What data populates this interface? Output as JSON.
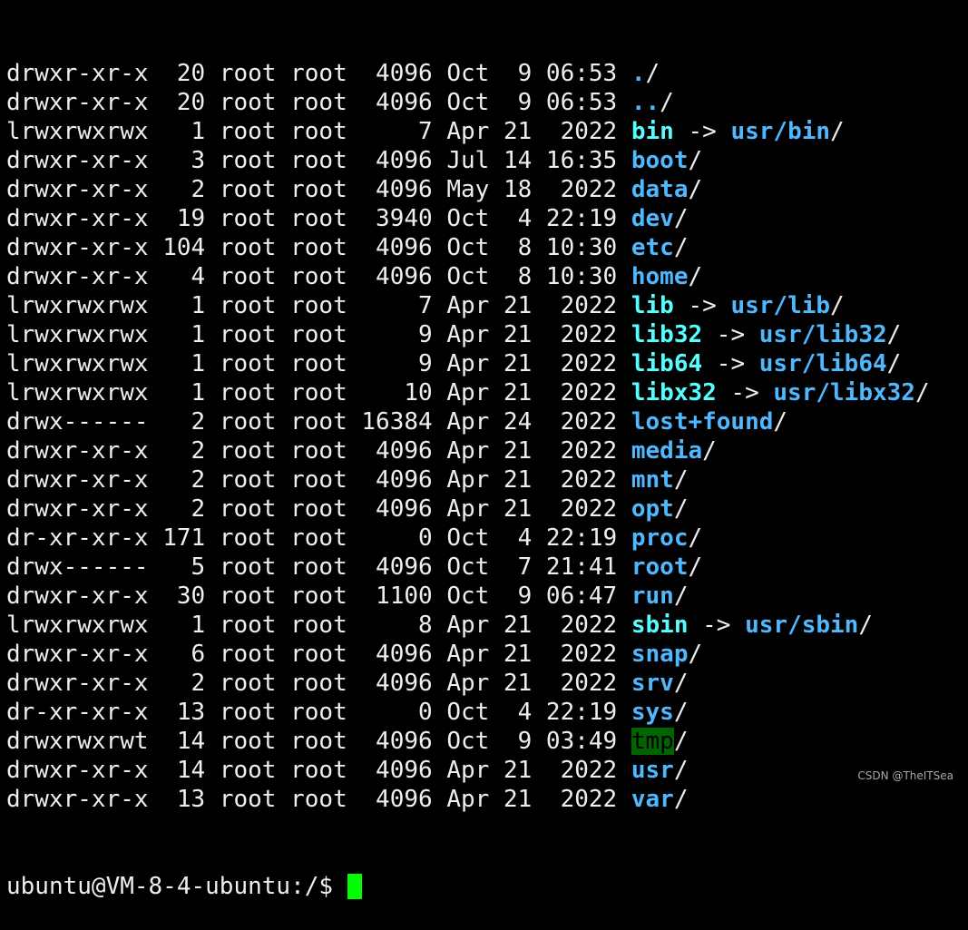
{
  "colors": {
    "directory": "#4fb8ff",
    "symlink": "#55ffff",
    "sticky_bg": "#006400",
    "cursor": "#00ff00",
    "text": "#eeeeee",
    "background": "#000000"
  },
  "listing": [
    {
      "perms": "drwxr-xr-x",
      "links": "20",
      "owner": "root",
      "group": "root",
      "size": "4096",
      "month": "Oct",
      "day": "9",
      "time": "06:53",
      "name": "./",
      "type": "dir"
    },
    {
      "perms": "drwxr-xr-x",
      "links": "20",
      "owner": "root",
      "group": "root",
      "size": "4096",
      "month": "Oct",
      "day": "9",
      "time": "06:53",
      "name": "../",
      "type": "dir"
    },
    {
      "perms": "lrwxrwxrwx",
      "links": "1",
      "owner": "root",
      "group": "root",
      "size": "7",
      "month": "Apr",
      "day": "21",
      "time": "2022",
      "name": "bin",
      "type": "link",
      "target": "usr/bin"
    },
    {
      "perms": "drwxr-xr-x",
      "links": "3",
      "owner": "root",
      "group": "root",
      "size": "4096",
      "month": "Jul",
      "day": "14",
      "time": "16:35",
      "name": "boot",
      "type": "dir"
    },
    {
      "perms": "drwxr-xr-x",
      "links": "2",
      "owner": "root",
      "group": "root",
      "size": "4096",
      "month": "May",
      "day": "18",
      "time": "2022",
      "name": "data",
      "type": "dir"
    },
    {
      "perms": "drwxr-xr-x",
      "links": "19",
      "owner": "root",
      "group": "root",
      "size": "3940",
      "month": "Oct",
      "day": "4",
      "time": "22:19",
      "name": "dev",
      "type": "dir"
    },
    {
      "perms": "drwxr-xr-x",
      "links": "104",
      "owner": "root",
      "group": "root",
      "size": "4096",
      "month": "Oct",
      "day": "8",
      "time": "10:30",
      "name": "etc",
      "type": "dir"
    },
    {
      "perms": "drwxr-xr-x",
      "links": "4",
      "owner": "root",
      "group": "root",
      "size": "4096",
      "month": "Oct",
      "day": "8",
      "time": "10:30",
      "name": "home",
      "type": "dir"
    },
    {
      "perms": "lrwxrwxrwx",
      "links": "1",
      "owner": "root",
      "group": "root",
      "size": "7",
      "month": "Apr",
      "day": "21",
      "time": "2022",
      "name": "lib",
      "type": "link",
      "target": "usr/lib"
    },
    {
      "perms": "lrwxrwxrwx",
      "links": "1",
      "owner": "root",
      "group": "root",
      "size": "9",
      "month": "Apr",
      "day": "21",
      "time": "2022",
      "name": "lib32",
      "type": "link",
      "target": "usr/lib32"
    },
    {
      "perms": "lrwxrwxrwx",
      "links": "1",
      "owner": "root",
      "group": "root",
      "size": "9",
      "month": "Apr",
      "day": "21",
      "time": "2022",
      "name": "lib64",
      "type": "link",
      "target": "usr/lib64"
    },
    {
      "perms": "lrwxrwxrwx",
      "links": "1",
      "owner": "root",
      "group": "root",
      "size": "10",
      "month": "Apr",
      "day": "21",
      "time": "2022",
      "name": "libx32",
      "type": "link",
      "target": "usr/libx32"
    },
    {
      "perms": "drwx------",
      "links": "2",
      "owner": "root",
      "group": "root",
      "size": "16384",
      "month": "Apr",
      "day": "24",
      "time": "2022",
      "name": "lost+found",
      "type": "dir"
    },
    {
      "perms": "drwxr-xr-x",
      "links": "2",
      "owner": "root",
      "group": "root",
      "size": "4096",
      "month": "Apr",
      "day": "21",
      "time": "2022",
      "name": "media",
      "type": "dir"
    },
    {
      "perms": "drwxr-xr-x",
      "links": "2",
      "owner": "root",
      "group": "root",
      "size": "4096",
      "month": "Apr",
      "day": "21",
      "time": "2022",
      "name": "mnt",
      "type": "dir"
    },
    {
      "perms": "drwxr-xr-x",
      "links": "2",
      "owner": "root",
      "group": "root",
      "size": "4096",
      "month": "Apr",
      "day": "21",
      "time": "2022",
      "name": "opt",
      "type": "dir"
    },
    {
      "perms": "dr-xr-xr-x",
      "links": "171",
      "owner": "root",
      "group": "root",
      "size": "0",
      "month": "Oct",
      "day": "4",
      "time": "22:19",
      "name": "proc",
      "type": "dir"
    },
    {
      "perms": "drwx------",
      "links": "5",
      "owner": "root",
      "group": "root",
      "size": "4096",
      "month": "Oct",
      "day": "7",
      "time": "21:41",
      "name": "root",
      "type": "dir"
    },
    {
      "perms": "drwxr-xr-x",
      "links": "30",
      "owner": "root",
      "group": "root",
      "size": "1100",
      "month": "Oct",
      "day": "9",
      "time": "06:47",
      "name": "run",
      "type": "dir"
    },
    {
      "perms": "lrwxrwxrwx",
      "links": "1",
      "owner": "root",
      "group": "root",
      "size": "8",
      "month": "Apr",
      "day": "21",
      "time": "2022",
      "name": "sbin",
      "type": "link",
      "target": "usr/sbin"
    },
    {
      "perms": "drwxr-xr-x",
      "links": "6",
      "owner": "root",
      "group": "root",
      "size": "4096",
      "month": "Apr",
      "day": "21",
      "time": "2022",
      "name": "snap",
      "type": "dir"
    },
    {
      "perms": "drwxr-xr-x",
      "links": "2",
      "owner": "root",
      "group": "root",
      "size": "4096",
      "month": "Apr",
      "day": "21",
      "time": "2022",
      "name": "srv",
      "type": "dir"
    },
    {
      "perms": "dr-xr-xr-x",
      "links": "13",
      "owner": "root",
      "group": "root",
      "size": "0",
      "month": "Oct",
      "day": "4",
      "time": "22:19",
      "name": "sys",
      "type": "dir"
    },
    {
      "perms": "drwxrwxrwt",
      "links": "14",
      "owner": "root",
      "group": "root",
      "size": "4096",
      "month": "Oct",
      "day": "9",
      "time": "03:49",
      "name": "tmp",
      "type": "sticky"
    },
    {
      "perms": "drwxr-xr-x",
      "links": "14",
      "owner": "root",
      "group": "root",
      "size": "4096",
      "month": "Apr",
      "day": "21",
      "time": "2022",
      "name": "usr",
      "type": "dir"
    },
    {
      "perms": "drwxr-xr-x",
      "links": "13",
      "owner": "root",
      "group": "root",
      "size": "4096",
      "month": "Apr",
      "day": "21",
      "time": "2022",
      "name": "var",
      "type": "dir"
    }
  ],
  "prompt": "ubuntu@VM-8-4-ubuntu:/$ ",
  "watermark": "CSDN @TheITSea"
}
